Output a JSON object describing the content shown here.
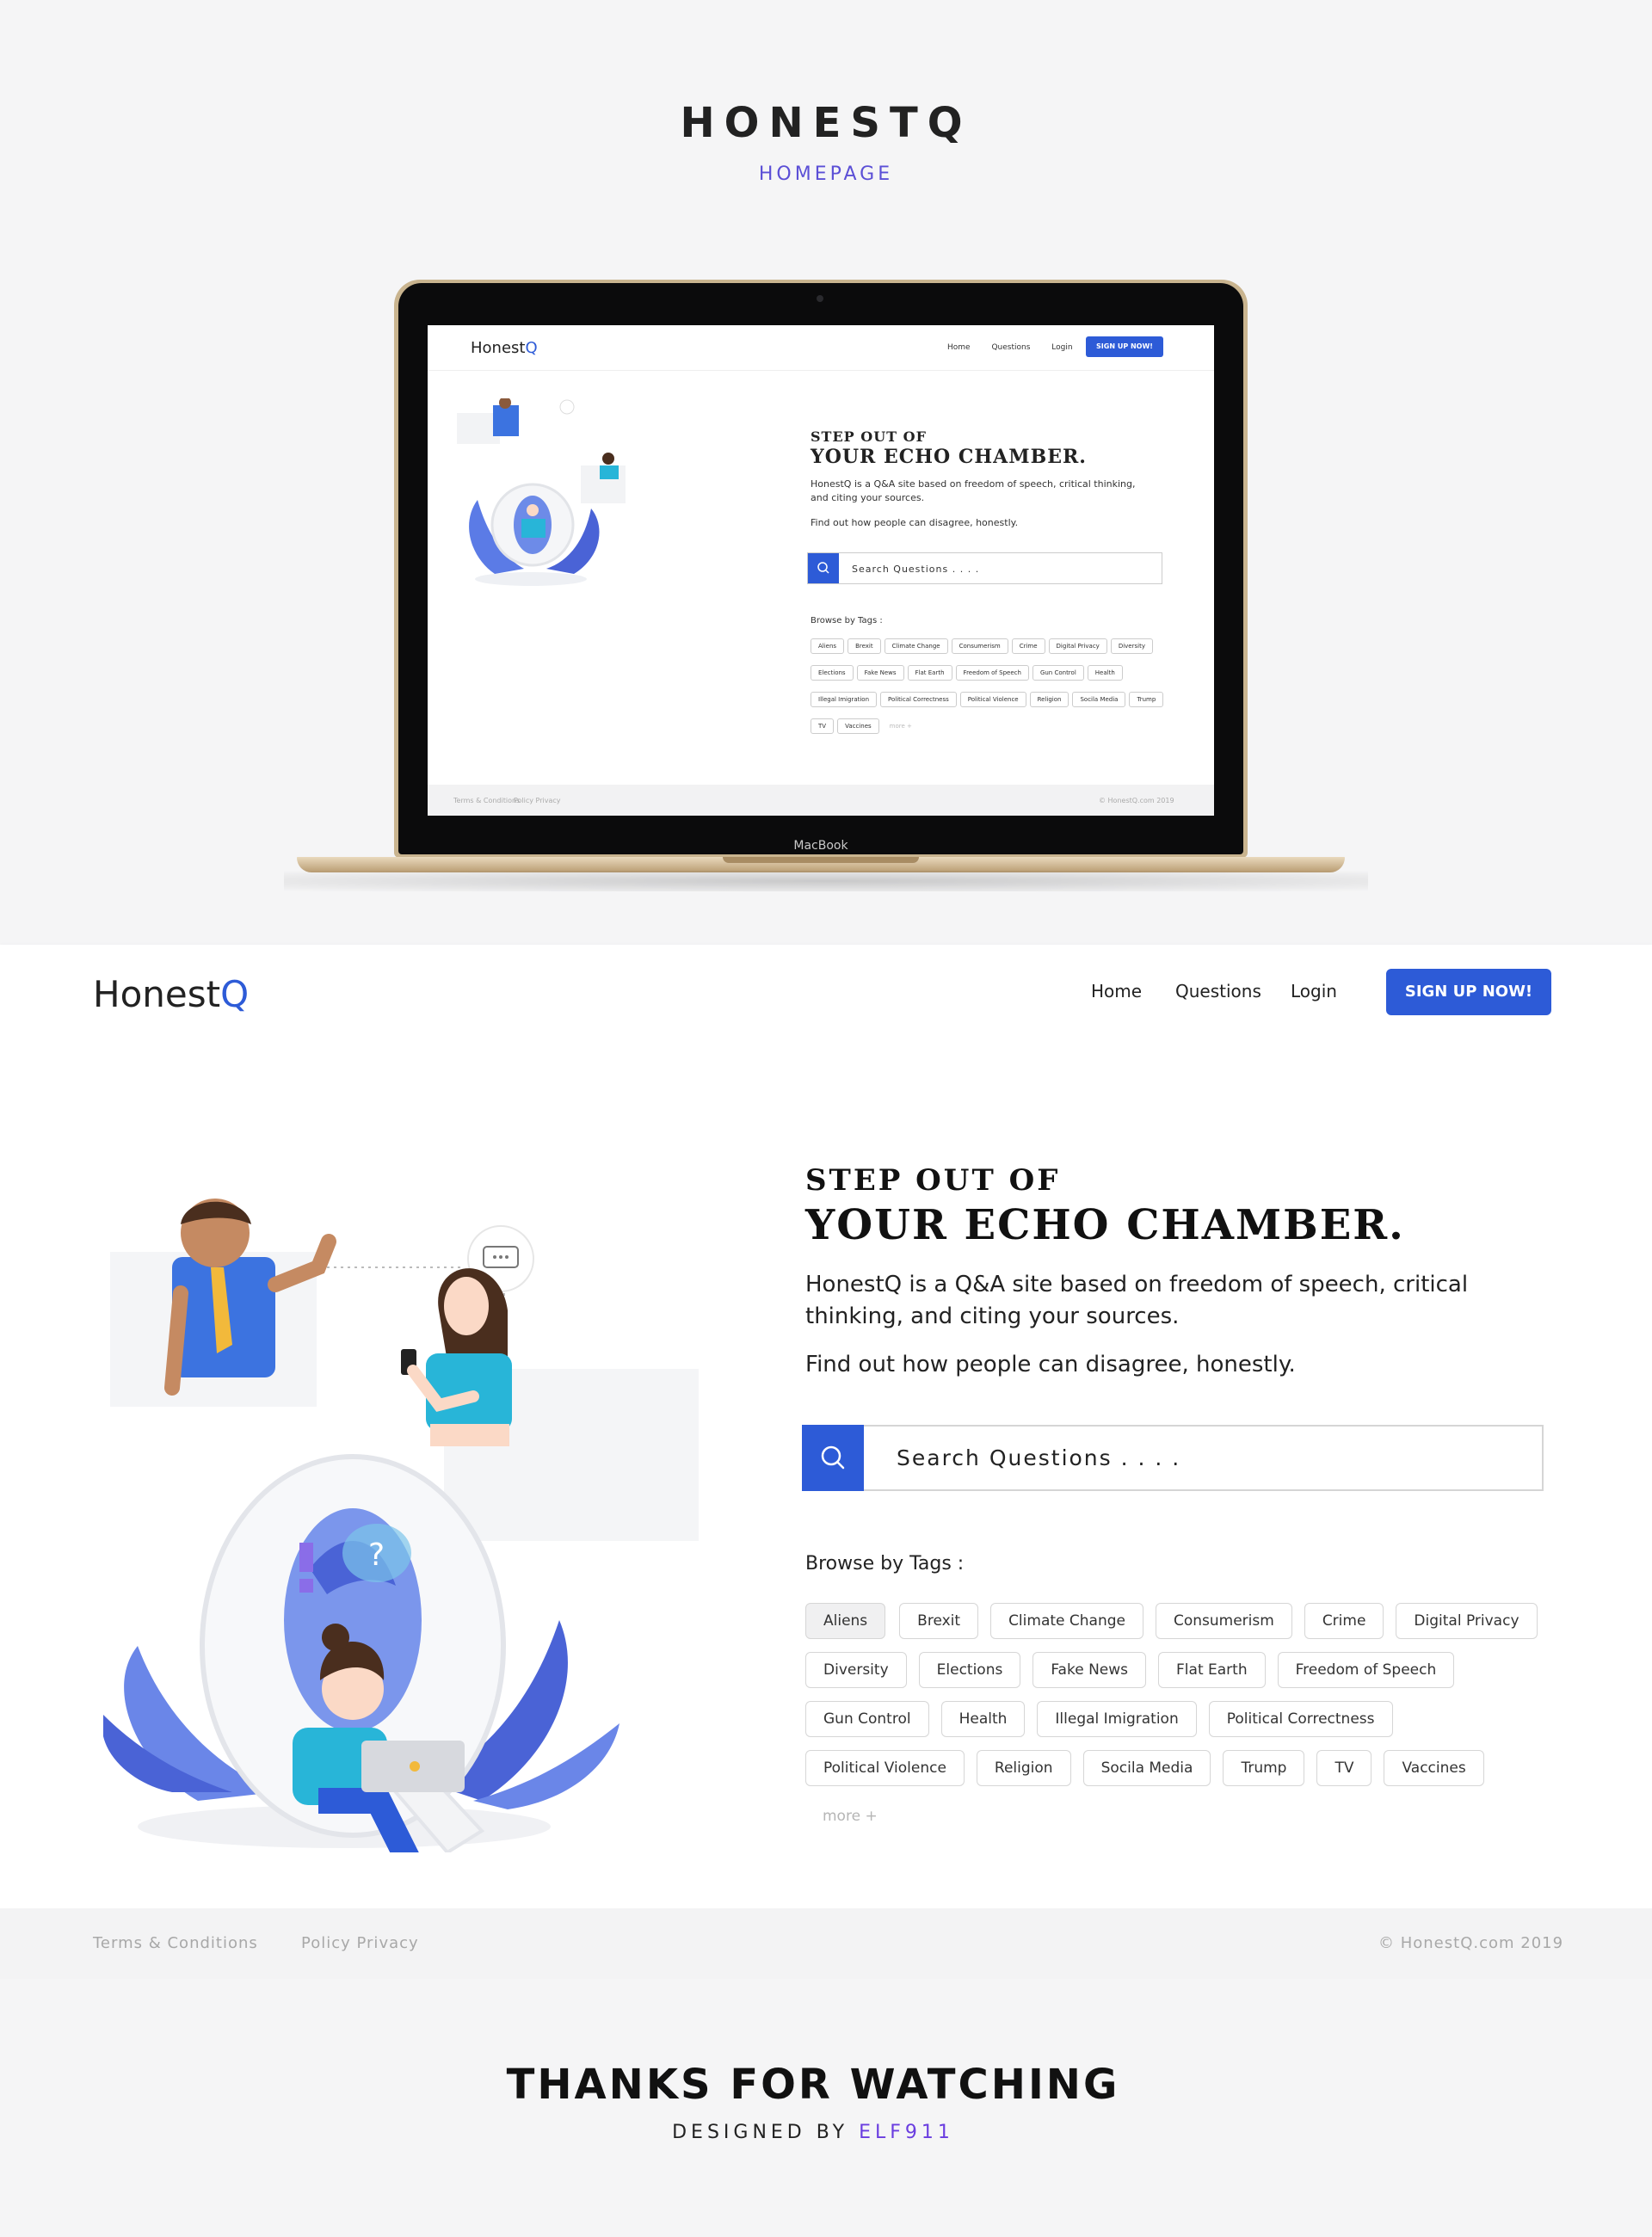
{
  "presentation": {
    "title": "HONESTQ",
    "subtitle": "HOMEPAGE"
  },
  "device": {
    "label": "MacBook"
  },
  "site": {
    "logo_text": "Honest",
    "logo_q": "Q",
    "nav": [
      "Home",
      "Questions",
      "Login"
    ],
    "signup_label": "SIGN UP NOW!",
    "hero": {
      "heading_small": "STEP OUT OF",
      "heading_big": "YOUR ECHO CHAMBER.",
      "paragraph1": "HonestQ is a Q&A site based on freedom of speech, critical thinking, and citing your sources.",
      "paragraph2": "Find out how people can disagree, honestly."
    },
    "search": {
      "placeholder": "Search Questions . . . .",
      "icon": "search-icon"
    },
    "browse_label": "Browse by Tags  :",
    "tags": [
      "Aliens",
      "Brexit",
      "Climate Change",
      "Consumerism",
      "Crime",
      "Digital Privacy",
      "Diversity",
      "Elections",
      "Fake News",
      "Flat Earth",
      "Freedom of Speech",
      "Gun Control",
      "Health",
      "Illegal Imigration",
      "Political Correctness",
      "Political Violence",
      "Religion",
      "Socila Media",
      "Trump",
      "TV",
      "Vaccines"
    ],
    "selected_tag": "Aliens",
    "more_label": "more +",
    "footer": {
      "terms": "Terms & Conditions",
      "privacy": "Policy Privacy",
      "copyright": "© HonestQ.com 2019"
    },
    "colors": {
      "accent": "#2d5bd7",
      "presentation_accent": "#5b4fd6"
    }
  },
  "closing": {
    "title": "THANKS FOR WATCHING",
    "designed_by": "DESIGNED BY",
    "designer": "ELF911"
  }
}
